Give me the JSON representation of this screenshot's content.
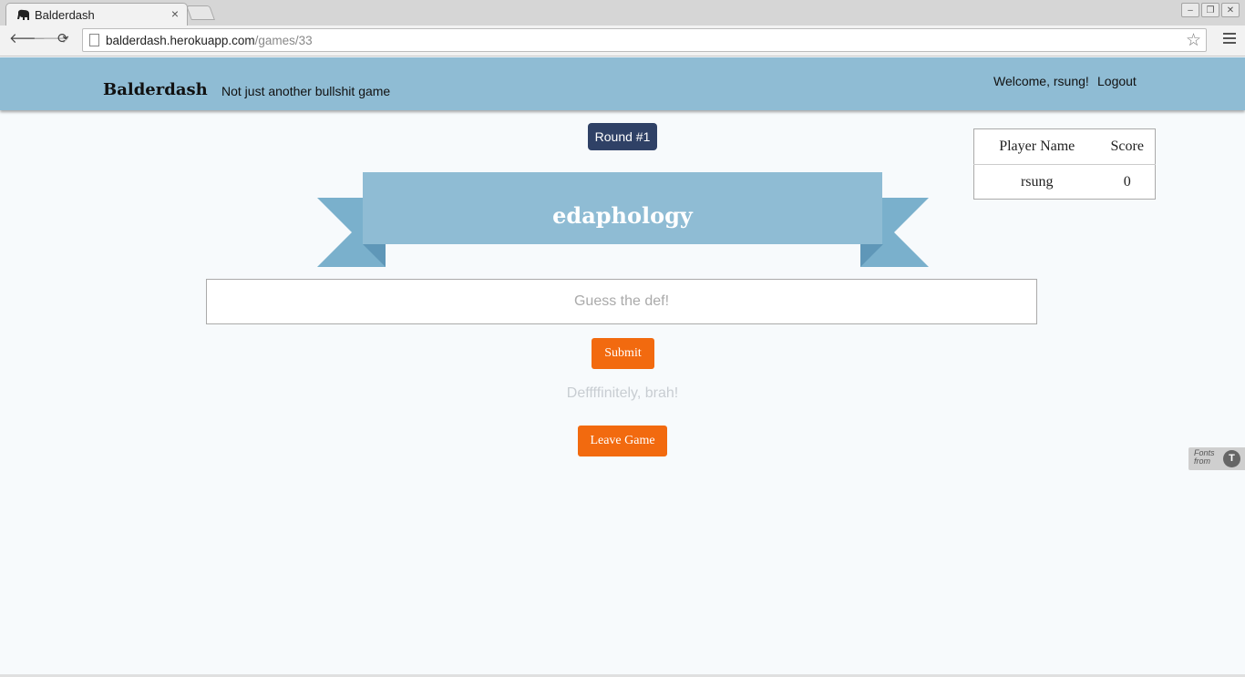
{
  "browser": {
    "tab_title": "Balderdash",
    "tab_close": "×",
    "url_host": "balderdash.herokuapp.com",
    "url_path": "/games/33",
    "back": "🡐",
    "forward": "🡒",
    "reload": "⟳",
    "star": "☆",
    "window_controls": {
      "minimize": "–",
      "restore": "❐",
      "close": "✕"
    }
  },
  "header": {
    "brand": "Balderdash",
    "tagline": "Not just another bullshit game",
    "welcome": "Welcome, rsung!",
    "logout": "Logout"
  },
  "game": {
    "round_label": "Round #1",
    "word": "edaphology",
    "guess_placeholder": "Guess the def!",
    "submit_label": "Submit",
    "status_message": "Deffffinitely, brah!",
    "leave_label": "Leave Game"
  },
  "scoreboard": {
    "headers": [
      "Player Name",
      "Score"
    ],
    "rows": [
      {
        "player": "rsung",
        "score": "0"
      }
    ]
  },
  "fonts_badge": {
    "line1": "Fonts",
    "line2": "from"
  },
  "colors": {
    "header_bg": "#8fbcd4",
    "round_badge": "#2f4166",
    "button_orange": "#f26a0f",
    "ribbon_main": "#8fbcd4",
    "ribbon_tail": "#7ab0cc"
  }
}
